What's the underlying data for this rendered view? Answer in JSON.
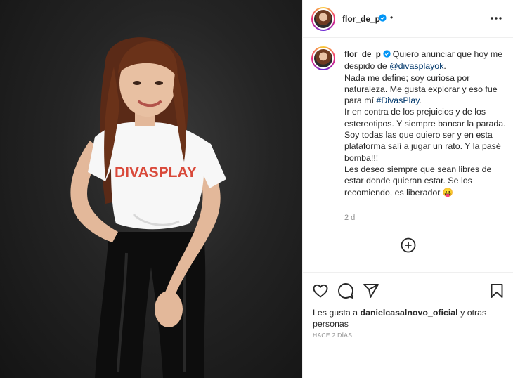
{
  "post": {
    "username": "flor_de_p",
    "separator": "•",
    "caption": {
      "username": "flor_de_p",
      "lines": [
        {
          "pre": "Quiero anunciar que hoy me despido de ",
          "mention": "@divasplayok",
          "post": "."
        },
        {
          "pre": "Nada me define; soy curiosa por naturaleza. Me gusta explorar y eso fue para mí ",
          "mention": "#DivasPlay",
          "post": "."
        },
        {
          "text": "Ir en contra de los prejuicios y de los estereotipos. Y siempre bancar la parada."
        },
        {
          "text": "Soy todas las que quiero ser y en esta plataforma salí a jugar un rato. Y la pasé bomba!!!"
        },
        {
          "text": "Les deseo siempre que sean libres de estar donde quieran estar. Se los recomiendo, es liberador 😛"
        }
      ]
    },
    "time_ago": "2 d",
    "likes": {
      "prefix": "Les gusta a ",
      "user": "danielcasalnovo_oficial",
      "suffix": " y otras personas"
    },
    "date": "HACE 2 DÍAS"
  },
  "photo": {
    "shirt_text": "DIVASPLAY",
    "shirt_text_color": "#d9493a"
  },
  "icons": {
    "verified": "verified-badge-icon",
    "more": "more-options-icon",
    "add": "add-comment-icon",
    "like": "heart-icon",
    "comment": "comment-icon",
    "share": "share-icon",
    "save": "bookmark-icon"
  },
  "colors": {
    "verified": "#0095f6",
    "mention": "#00376b",
    "muted": "#8e8e8e",
    "text": "#262626"
  }
}
